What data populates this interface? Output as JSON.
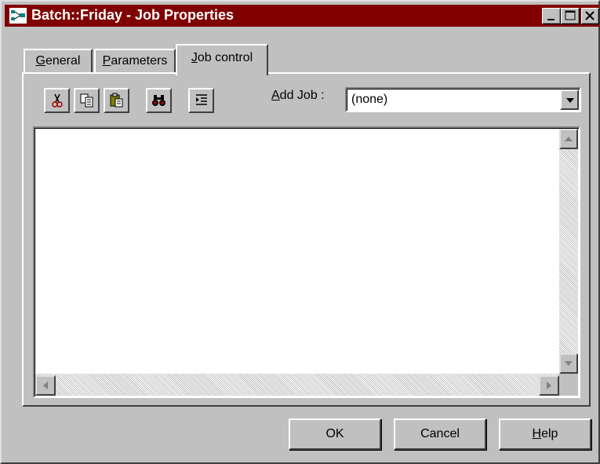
{
  "window": {
    "title": "Batch::Friday - Job Properties",
    "title_bar_color": "#800000"
  },
  "tabs": [
    {
      "label": "General",
      "accel": "G",
      "rest": "eneral",
      "selected": false
    },
    {
      "label": "Parameters",
      "accel": "P",
      "rest": "arameters",
      "selected": false
    },
    {
      "label": "Job control",
      "accel": "J",
      "rest": "ob control",
      "selected": true
    }
  ],
  "toolbar": {
    "icons": [
      "scissors-icon",
      "copy-icon",
      "paste-icon",
      "binoculars-icon",
      "indent-icon"
    ]
  },
  "add_job": {
    "label_accel": "A",
    "label_rest": "dd Job :",
    "value": "(none)"
  },
  "editor": {
    "content": ""
  },
  "buttons": {
    "ok": "OK",
    "cancel": "Cancel",
    "help_accel": "H",
    "help_rest": "elp"
  }
}
